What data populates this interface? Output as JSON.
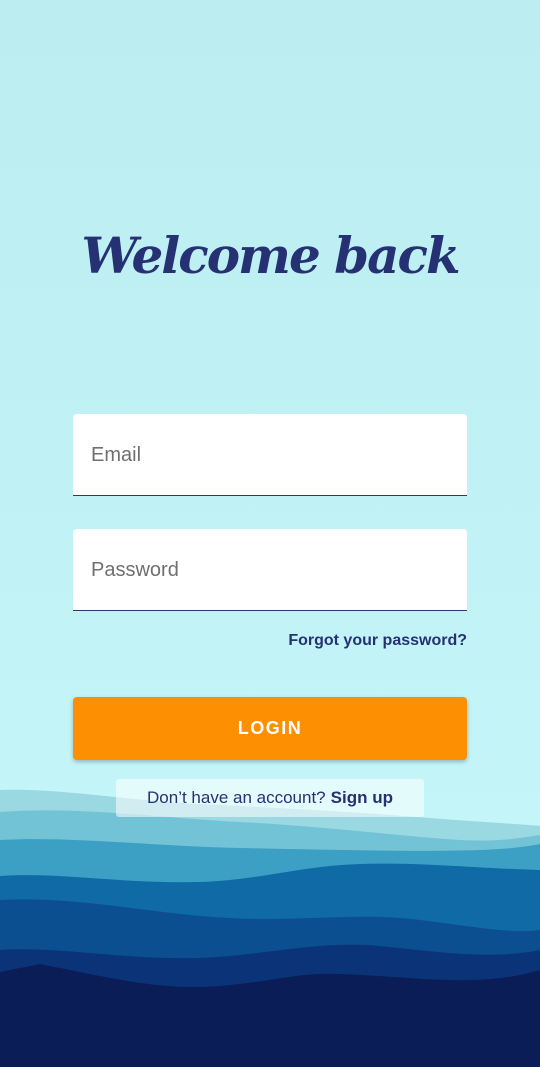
{
  "header": {
    "title": "Welcome back"
  },
  "form": {
    "email_placeholder": "Email",
    "password_placeholder": "Password",
    "forgot_label": "Forgot your password?",
    "login_label": "LOGIN"
  },
  "footer": {
    "prompt": "Don’t have an account?",
    "signup_label": "Sign up"
  },
  "colors": {
    "title": "#253173",
    "button": "#fd8f02",
    "sky": "#bcedf1",
    "mountain_dark": "#0a1a52"
  }
}
